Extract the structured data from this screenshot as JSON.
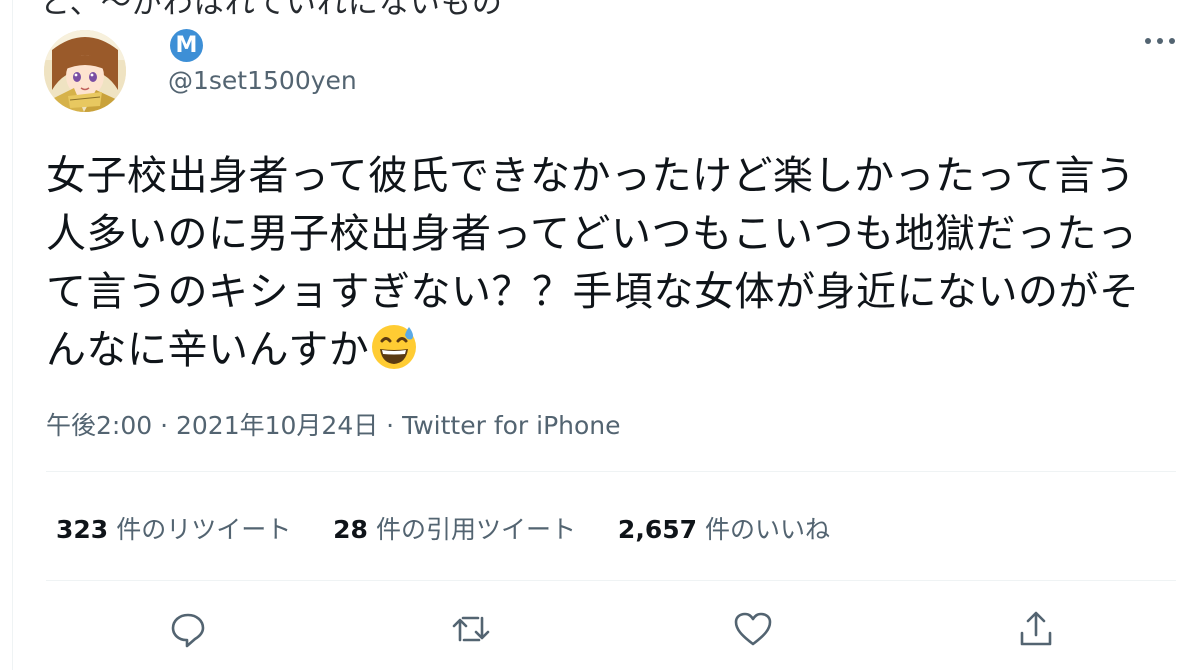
{
  "top_cut_text": "と、〜がわはれていれにないもの",
  "user": {
    "handle": "@1set1500yen",
    "badge_letter": "M",
    "badge_color": "#3d8fd6"
  },
  "tweet": {
    "text": "女子校出身者って彼氏できなかったけど楽しかったって言う人多いのに男子校出身者ってどいつもこいつも地獄だったって言うのキショすぎない？？手頃な女体が身近にないのがそんなに辛いんすか",
    "emoji": "grinning-face-with-sweat"
  },
  "meta": {
    "time": "午後2:00",
    "sep1": " · ",
    "date": "2021年10月24日",
    "sep2": " · ",
    "source": "Twitter for iPhone"
  },
  "stats": {
    "retweets_count": "323",
    "retweets_label": "件のリツイート",
    "quotes_count": "28",
    "quotes_label": "件の引用ツイート",
    "likes_count": "2,657",
    "likes_label": "件のいいね"
  },
  "icons": {
    "more": "more-horizontal-icon",
    "reply": "reply-icon",
    "retweet": "retweet-icon",
    "like": "heart-icon",
    "share": "share-icon"
  },
  "colors": {
    "text": "#0f1419",
    "secondary": "#536471",
    "divider": "#eff3f4"
  }
}
